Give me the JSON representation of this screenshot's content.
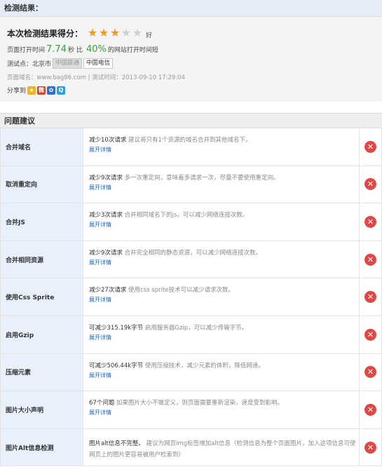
{
  "result": {
    "heading": "检测结果：",
    "score_label": "本次检测结果得分：",
    "stars": [
      1,
      1,
      1,
      0,
      0
    ],
    "star_on_color": "#f29a1e",
    "score_word": "好",
    "speed_prefix": "页面打开时间",
    "speed_value": "7.74",
    "speed_unit": "秒",
    "compare_word": "比",
    "percent": "40%",
    "speed_suffix": "的网站打开时间短",
    "test_label": "测试点：北京市",
    "locations": [
      {
        "label": "中国联通",
        "selected": false
      },
      {
        "label": "中国电信",
        "selected": true
      }
    ],
    "meta": "页面域名：www.bag86.com | 测试时间：2013-09-10 17:29:04",
    "share_label": "分享到",
    "share_icons": [
      "qzone-icon",
      "weibo-icon",
      "baidu-icon",
      "qq-icon"
    ]
  },
  "issues": {
    "heading": "问题建议",
    "expand_label": "展开详情",
    "rows": [
      {
        "name": "合并域名",
        "lead": "减少10次请求",
        "detail": "建议将只有1个资源的域名合并到其他域名下。",
        "expand": true
      },
      {
        "name": "取消重定向",
        "lead": "减少9次请求",
        "detail": "多一次重定向，意味着多请求一次，尽量不要使用重定向。",
        "expand": true
      },
      {
        "name": "合并JS",
        "lead": "减少3次请求",
        "detail": "合并相同域名下的js，可以减少网络连接次数。",
        "expand": true
      },
      {
        "name": "合并相同资源",
        "lead": "减少9次请求",
        "detail": "合并完全相同的静态资源，可以减少网络连接次数。",
        "expand": true
      },
      {
        "name": "使用Css Sprite",
        "lead": "减少27次请求",
        "detail": "使用css sprite技术可以减少请求次数。",
        "expand": true
      },
      {
        "name": "启用Gzip",
        "lead": "可减少315.19k字节",
        "detail": "启用服务器Gzip，可以减少传输字节。",
        "expand": true
      },
      {
        "name": "压缩元素",
        "lead": "可减少506.44k字节",
        "detail": "使用压缩技术，减少元素的体积，降低网速。",
        "expand": true
      },
      {
        "name": "图片大小声明",
        "lead": "67个问题",
        "detail": "如果图片大小不做定义，则页面需要重新渲染，速度受到影响。",
        "expand": true
      },
      {
        "name": "图片Alt信息检测",
        "lead": "图片alt信息不完整。",
        "detail": "建议为网页img标签增加alt信息（检测信息为整个页面图片，加入这项信息可使网页上的图片更容易被用户检索到）",
        "expand": false
      }
    ]
  }
}
